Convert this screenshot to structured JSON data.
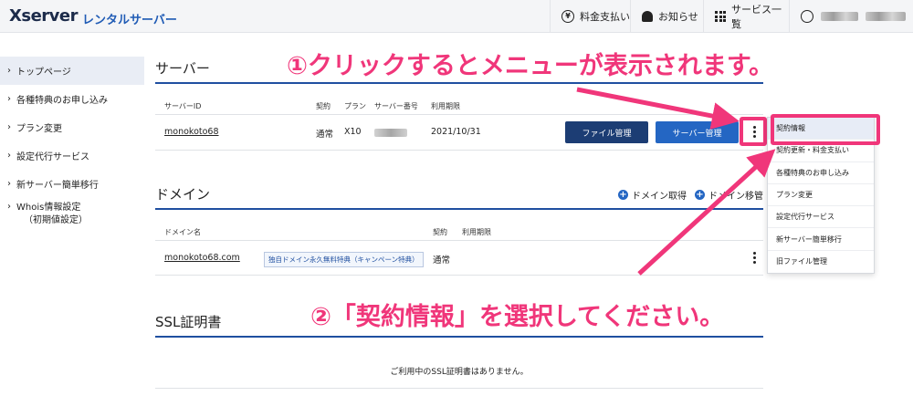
{
  "header": {
    "logo_main": "Xserver",
    "logo_sub": "レンタルサーバー",
    "payment_label": "料金支払い",
    "news_label": "お知らせ",
    "services_label": "サービス一覧"
  },
  "sidebar": {
    "items": [
      {
        "label": "トップページ"
      },
      {
        "label": "各種特典のお申し込み"
      },
      {
        "label": "プラン変更"
      },
      {
        "label": "設定代行サービス"
      },
      {
        "label": "新サーバー簡単移行"
      }
    ],
    "whois_line1": "Whois情報設定",
    "whois_line2": "（初期値設定）"
  },
  "server": {
    "title": "サーバー",
    "columns": [
      "サーバーID",
      "契約",
      "プラン",
      "サーバー番号",
      "利用期限"
    ],
    "row": {
      "id": "monokoto68",
      "contract": "通常",
      "plan": "X10",
      "expiry": "2021/10/31"
    },
    "file_manage_btn": "ファイル管理",
    "server_manage_btn": "サーバー管理"
  },
  "domain": {
    "title": "ドメイン",
    "get_link": "ドメイン取得",
    "migrate_link": "ドメイン移管",
    "columns": [
      "ドメイン名",
      "契約",
      "利用期限"
    ],
    "row": {
      "name": "monokoto68.com",
      "tag": "独自ドメイン永久無料特典（キャンペーン特典）",
      "contract": "通常"
    }
  },
  "ssl": {
    "title": "SSL証明書",
    "empty_message": "ご利用中のSSL証明書はありません。"
  },
  "menu": {
    "items": [
      {
        "label": "契約情報"
      },
      {
        "label": "契約更新・料金支払い"
      },
      {
        "label": "各種特典のお申し込み"
      },
      {
        "label": "プラン変更"
      },
      {
        "label": "設定代行サービス"
      },
      {
        "label": "新サーバー簡単移行"
      },
      {
        "label": "旧ファイル管理"
      }
    ]
  },
  "annotations": {
    "step1": "①クリックするとメニューが表示されます。",
    "step2": "②「契約情報」を選択してください。"
  },
  "colors": {
    "accent_pink": "#f0367a",
    "navy": "#1c3d74",
    "blue": "#2466c3"
  }
}
